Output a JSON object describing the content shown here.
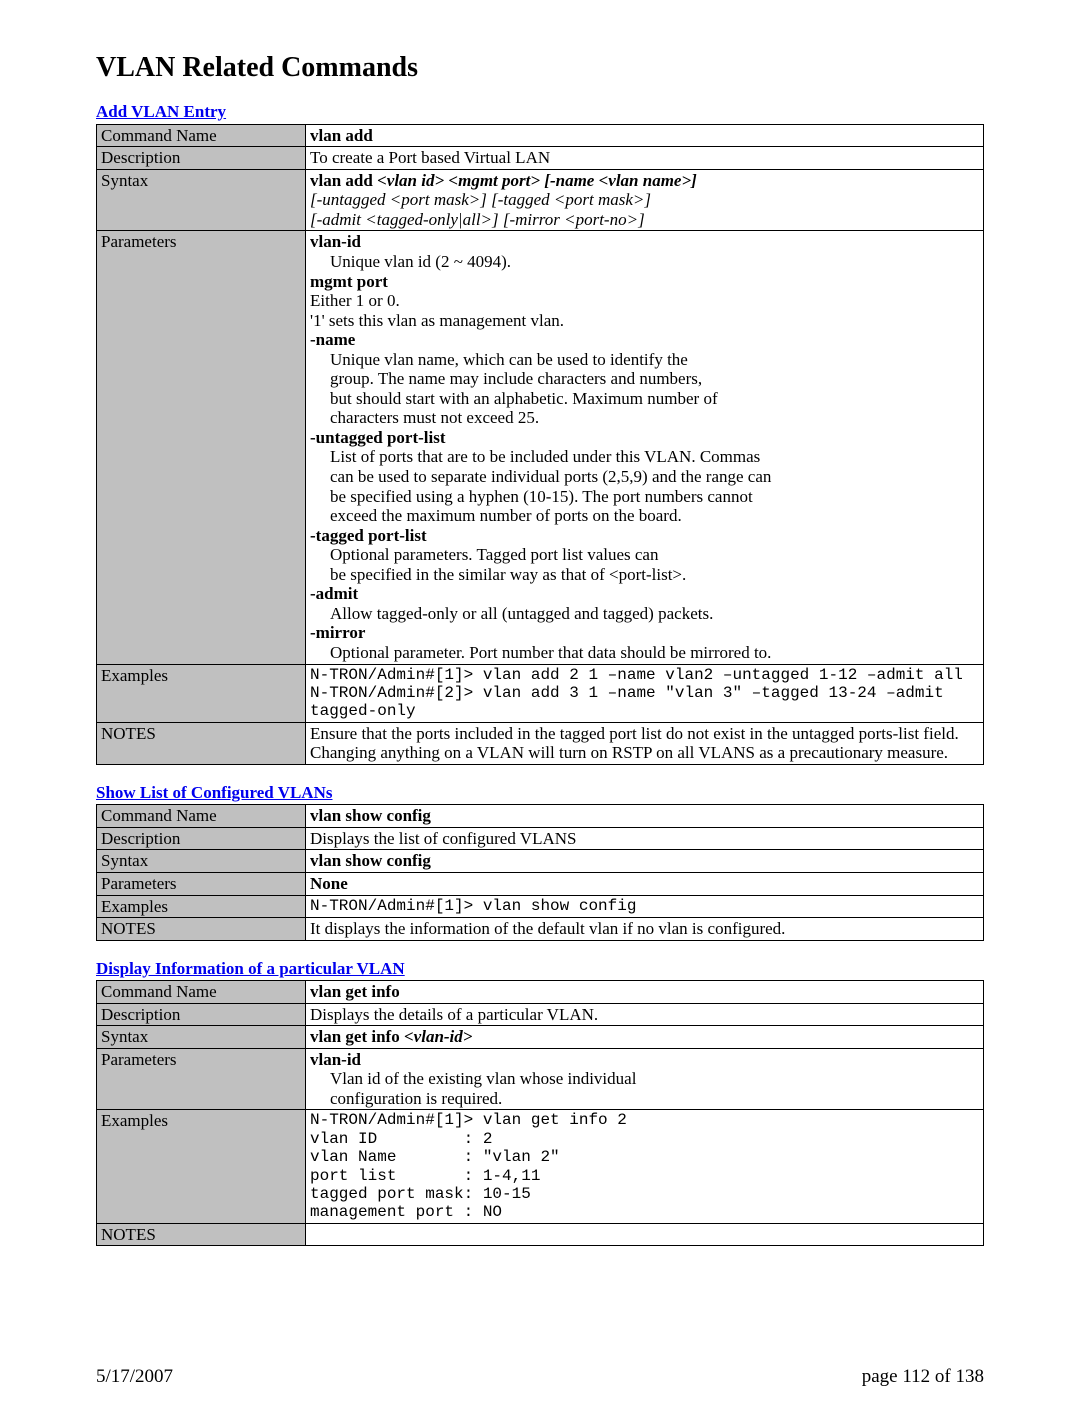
{
  "page_title": "VLAN Related Commands",
  "footer": {
    "date": "5/17/2007",
    "page": "page 112 of 138"
  },
  "labels": {
    "command_name": "Command Name",
    "description": "Description",
    "syntax": "Syntax",
    "parameters": "Parameters",
    "examples": "Examples",
    "notes": "NOTES"
  },
  "add_vlan": {
    "section_title": "Add VLAN Entry",
    "command_name": "vlan add",
    "description": "To create a Port based Virtual LAN",
    "syntax": {
      "prefix": "vlan add ",
      "line1": " <vlan id> <mgmt port> [-name <vlan name>]",
      "line2": "[-untagged <port mask>] [-tagged <port mask>]",
      "line3": "[-admit <tagged-only|all>] [-mirror <port-no>]"
    },
    "params": {
      "p1_name": "vlan-id",
      "p1_desc": "Unique vlan id (2 ~ 4094).",
      "p2_name": "mgmt port",
      "p2_l1": "Either 1 or 0.",
      "p2_l2": "'1' sets this vlan as management vlan.",
      "p3_name": "-name",
      "p3_l1": "Unique vlan name, which can be used to identify the",
      "p3_l2": "group. The name may include characters and numbers,",
      "p3_l3": "but should start with an alphabetic. Maximum number of",
      "p3_l4": "characters must not exceed 25.",
      "p4_name": "-untagged port-list",
      "p4_l1": "List of ports that are to be included under this VLAN.  Commas",
      "p4_l2": "can be used to separate individual ports (2,5,9) and the range can",
      "p4_l3": "be specified using a hyphen (10-15).  The port numbers cannot",
      "p4_l4": "exceed the maximum number of ports on the board.",
      "p5_name": "-tagged port-list",
      "p5_l1": "Optional parameters.  Tagged port list values can",
      "p5_l2": "be specified in the similar way as that of <port-list>.",
      "p6_name": "-admit",
      "p6_l1": "Allow tagged-only or all (untagged and tagged) packets.",
      "p7_name": "-mirror",
      "p7_l1": "Optional parameter.  Port number that data should be mirrored to."
    },
    "examples": "N-TRON/Admin#[1]> vlan add 2 1 –name vlan2 –untagged 1-12 –admit all\nN-TRON/Admin#[2]> vlan add 3 1 –name \"vlan 3\" –tagged 13-24 –admit tagged-only",
    "notes": "Ensure that the ports included in the tagged port list do not exist in the untagged ports-list field.  Changing anything on a VLAN will turn on RSTP on all VLANS as a precautionary measure."
  },
  "show_config": {
    "section_title": "Show List of Configured VLANs",
    "command_name": "vlan show config",
    "description": "Displays the list of configured VLANS",
    "syntax": "vlan show config",
    "parameters": "None",
    "examples": "N-TRON/Admin#[1]> vlan show config",
    "notes": "It displays the information of the default vlan if no vlan is configured."
  },
  "get_info": {
    "section_title": "Display Information of a particular VLAN",
    "command_name": "vlan get info",
    "description": "Displays the details of a particular VLAN.",
    "syntax_prefix": "vlan get info ",
    "syntax_arg": "<vlan-id>",
    "params": {
      "p1_name": "vlan-id",
      "p1_l1": "Vlan id of the existing vlan whose individual",
      "p1_l2": "configuration is required."
    },
    "examples": "N-TRON/Admin#[1]> vlan get info 2\nvlan ID         : 2\nvlan Name       : \"vlan 2\"\nport list       : 1-4,11\ntagged port mask: 10-15\nmanagement port : NO",
    "notes": ""
  }
}
